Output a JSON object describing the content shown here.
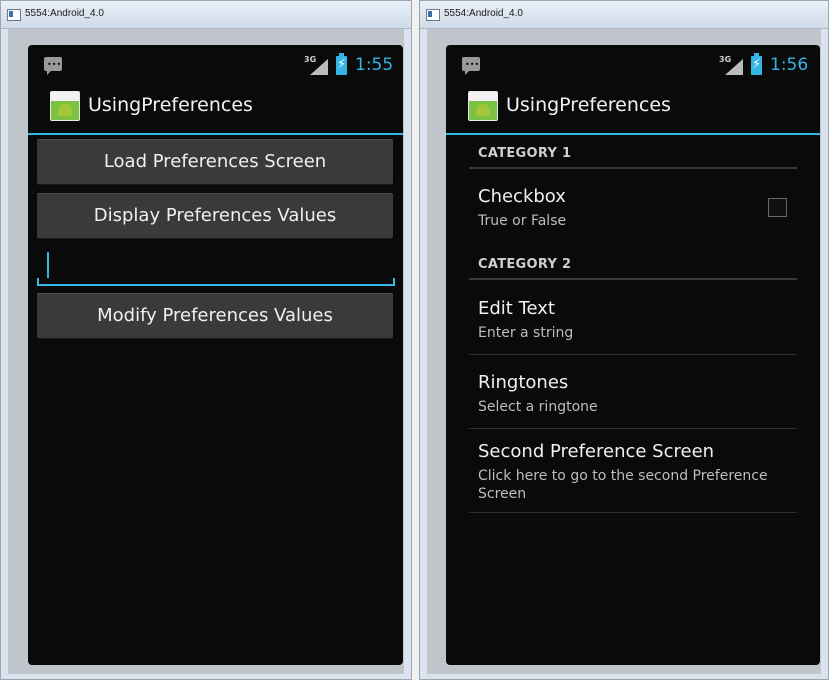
{
  "windows": [
    {
      "title": "5554:Android_4.0",
      "status": {
        "network": "3G",
        "time": "1:55"
      },
      "app_title": "UsingPreferences",
      "buttons": {
        "load": "Load Preferences Screen",
        "display": "Display Preferences Values",
        "modify": "Modify Preferences Values"
      },
      "edit_value": ""
    },
    {
      "title": "5554:Android_4.0",
      "status": {
        "network": "3G",
        "time": "1:56"
      },
      "app_title": "UsingPreferences",
      "categories": [
        "CATEGORY 1",
        "CATEGORY 2"
      ],
      "prefs": [
        {
          "title": "Checkbox",
          "summary": "True or False",
          "checked": false
        },
        {
          "title": "Edit Text",
          "summary": "Enter a string"
        },
        {
          "title": "Ringtones",
          "summary": "Select a ringtone"
        },
        {
          "title": "Second Preference Screen",
          "summary": "Click here to go to the second Preference Screen"
        }
      ]
    }
  ],
  "colors": {
    "accent": "#33b5e5",
    "screen_bg": "#0a0a0a",
    "button_bg": "#3a3a3a"
  },
  "icons": [
    "window-icon",
    "notification-icon",
    "signal-icon",
    "battery-charging-icon",
    "app-icon",
    "checkbox-icon"
  ]
}
